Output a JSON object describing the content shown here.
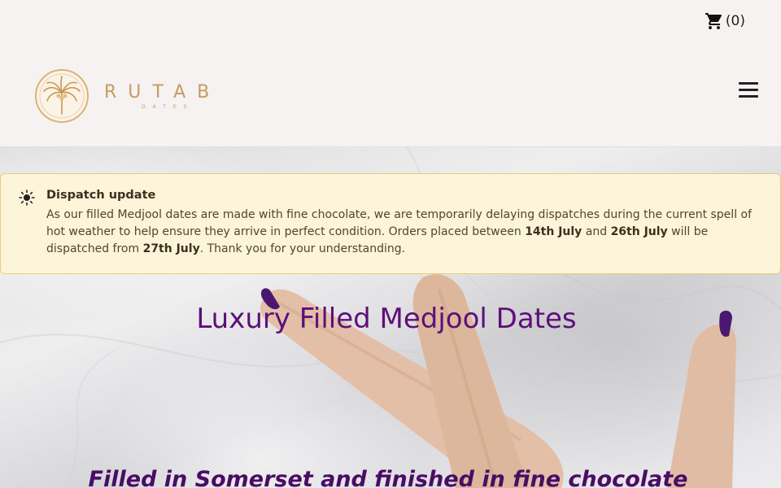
{
  "header": {
    "cart_count": "(0)",
    "brand_name": "RUTAB",
    "brand_sub": "DATES"
  },
  "icons": {
    "cart": "cart-icon",
    "menu": "hamburger-menu-icon",
    "notice": "sun-icon",
    "logo": "palm-tree-logo"
  },
  "notice": {
    "title": "Dispatch update",
    "body_1": "As our filled Medjool dates are made with fine chocolate, we are temporarily delaying dispatches during the current spell of hot weather to help ensure they arrive in perfect condition. Orders placed between ",
    "date_1": "14th July",
    "body_2": " and ",
    "date_2": "26th July",
    "body_3": " will be dispatched from ",
    "date_3": "27th July",
    "body_4": ". Thank you for your understanding."
  },
  "hero": {
    "title": "Luxury Filled Medjool Dates",
    "subtitle": "Filled in Somerset and finished in fine chocolate"
  },
  "colors": {
    "brand_gold": "#c79a61",
    "headline_purple": "#5e0f7a",
    "notice_bg": "#fdf5d9",
    "notice_border": "#eacb7a"
  }
}
